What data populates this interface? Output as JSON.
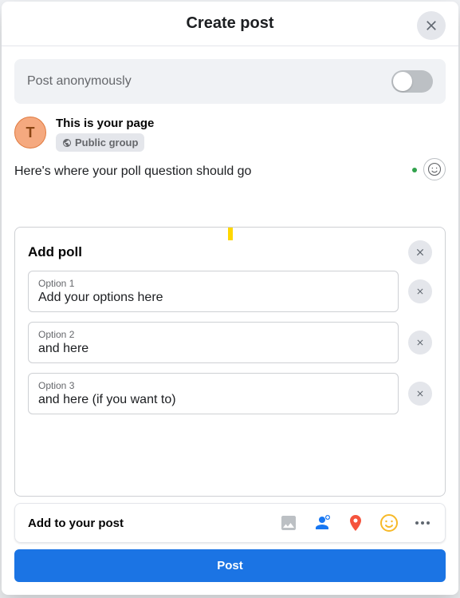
{
  "header": {
    "title": "Create post"
  },
  "anonymous": {
    "label": "Post anonymously",
    "enabled": false
  },
  "author": {
    "initial": "T",
    "name": "This is your page",
    "privacy": "Public group"
  },
  "post_text": "Here's where your poll question should go",
  "poll": {
    "title": "Add poll",
    "options": [
      {
        "label": "Option 1",
        "value": "Add your options here"
      },
      {
        "label": "Option 2",
        "value": "and here"
      },
      {
        "label": "Option 3",
        "value": "and here (if you want to)"
      }
    ]
  },
  "add_to_post": {
    "label": "Add to your post"
  },
  "submit": {
    "label": "Post"
  }
}
